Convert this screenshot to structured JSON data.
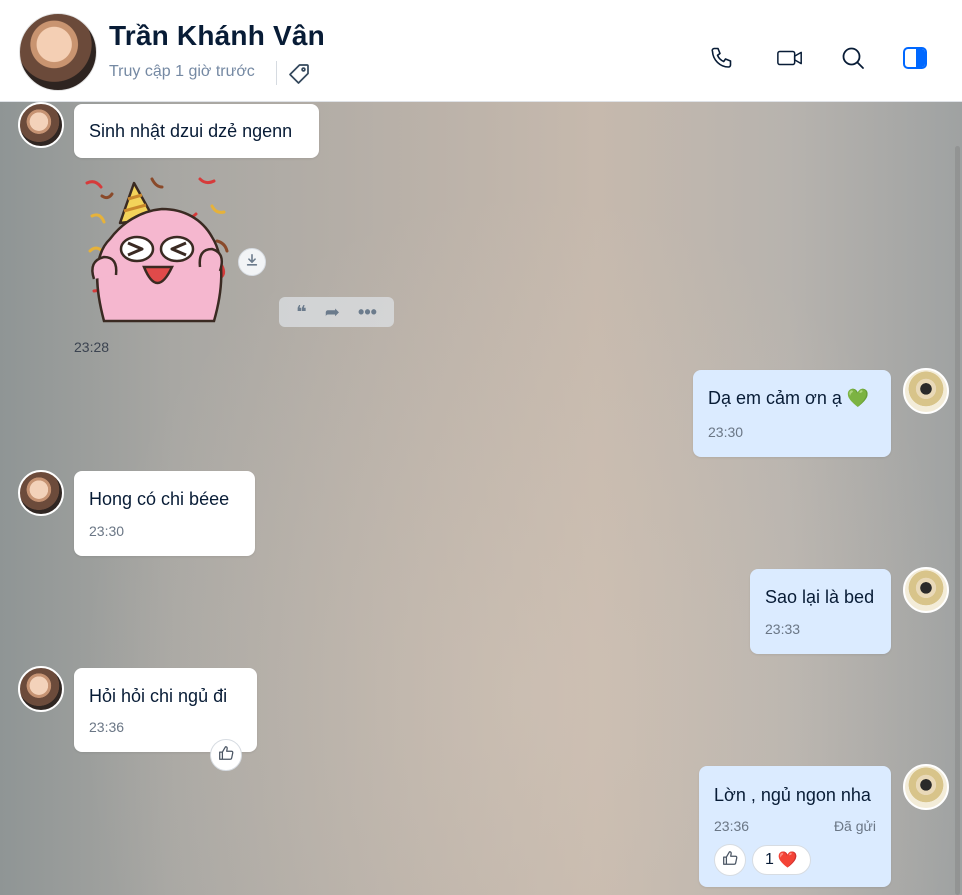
{
  "header": {
    "contact_name": "Trần Khánh Vân",
    "status": "Truy cập 1 giờ trước",
    "icons": [
      "tag-icon",
      "phone-icon",
      "video-call-icon",
      "search-icon",
      "sidebar-toggle-icon"
    ],
    "accent_color": "#0068ff"
  },
  "messages": [
    {
      "from": "contact",
      "text": "Sinh nhật dzui dzẻ ngenn"
    },
    {
      "from": "contact",
      "type": "sticker",
      "sticker": "party-bunny-sticker",
      "time": "23:28",
      "actions": {
        "quote": "❝",
        "forward": "➦",
        "more": "•••"
      }
    },
    {
      "from": "me",
      "text": "Dạ em cảm ơn ạ 💚",
      "time": "23:30"
    },
    {
      "from": "contact",
      "text": "Hong có chi béee",
      "time": "23:30"
    },
    {
      "from": "me",
      "text": "Sao lại là bed",
      "time": "23:33"
    },
    {
      "from": "contact",
      "text": "Hỏi hỏi chi ngủ đi",
      "time": "23:36"
    },
    {
      "from": "me",
      "text": "Lờn , ngủ ngon nha",
      "time": "23:36",
      "status": "Đã gửi",
      "reaction": {
        "count": "1",
        "emoji": "❤️"
      }
    }
  ]
}
